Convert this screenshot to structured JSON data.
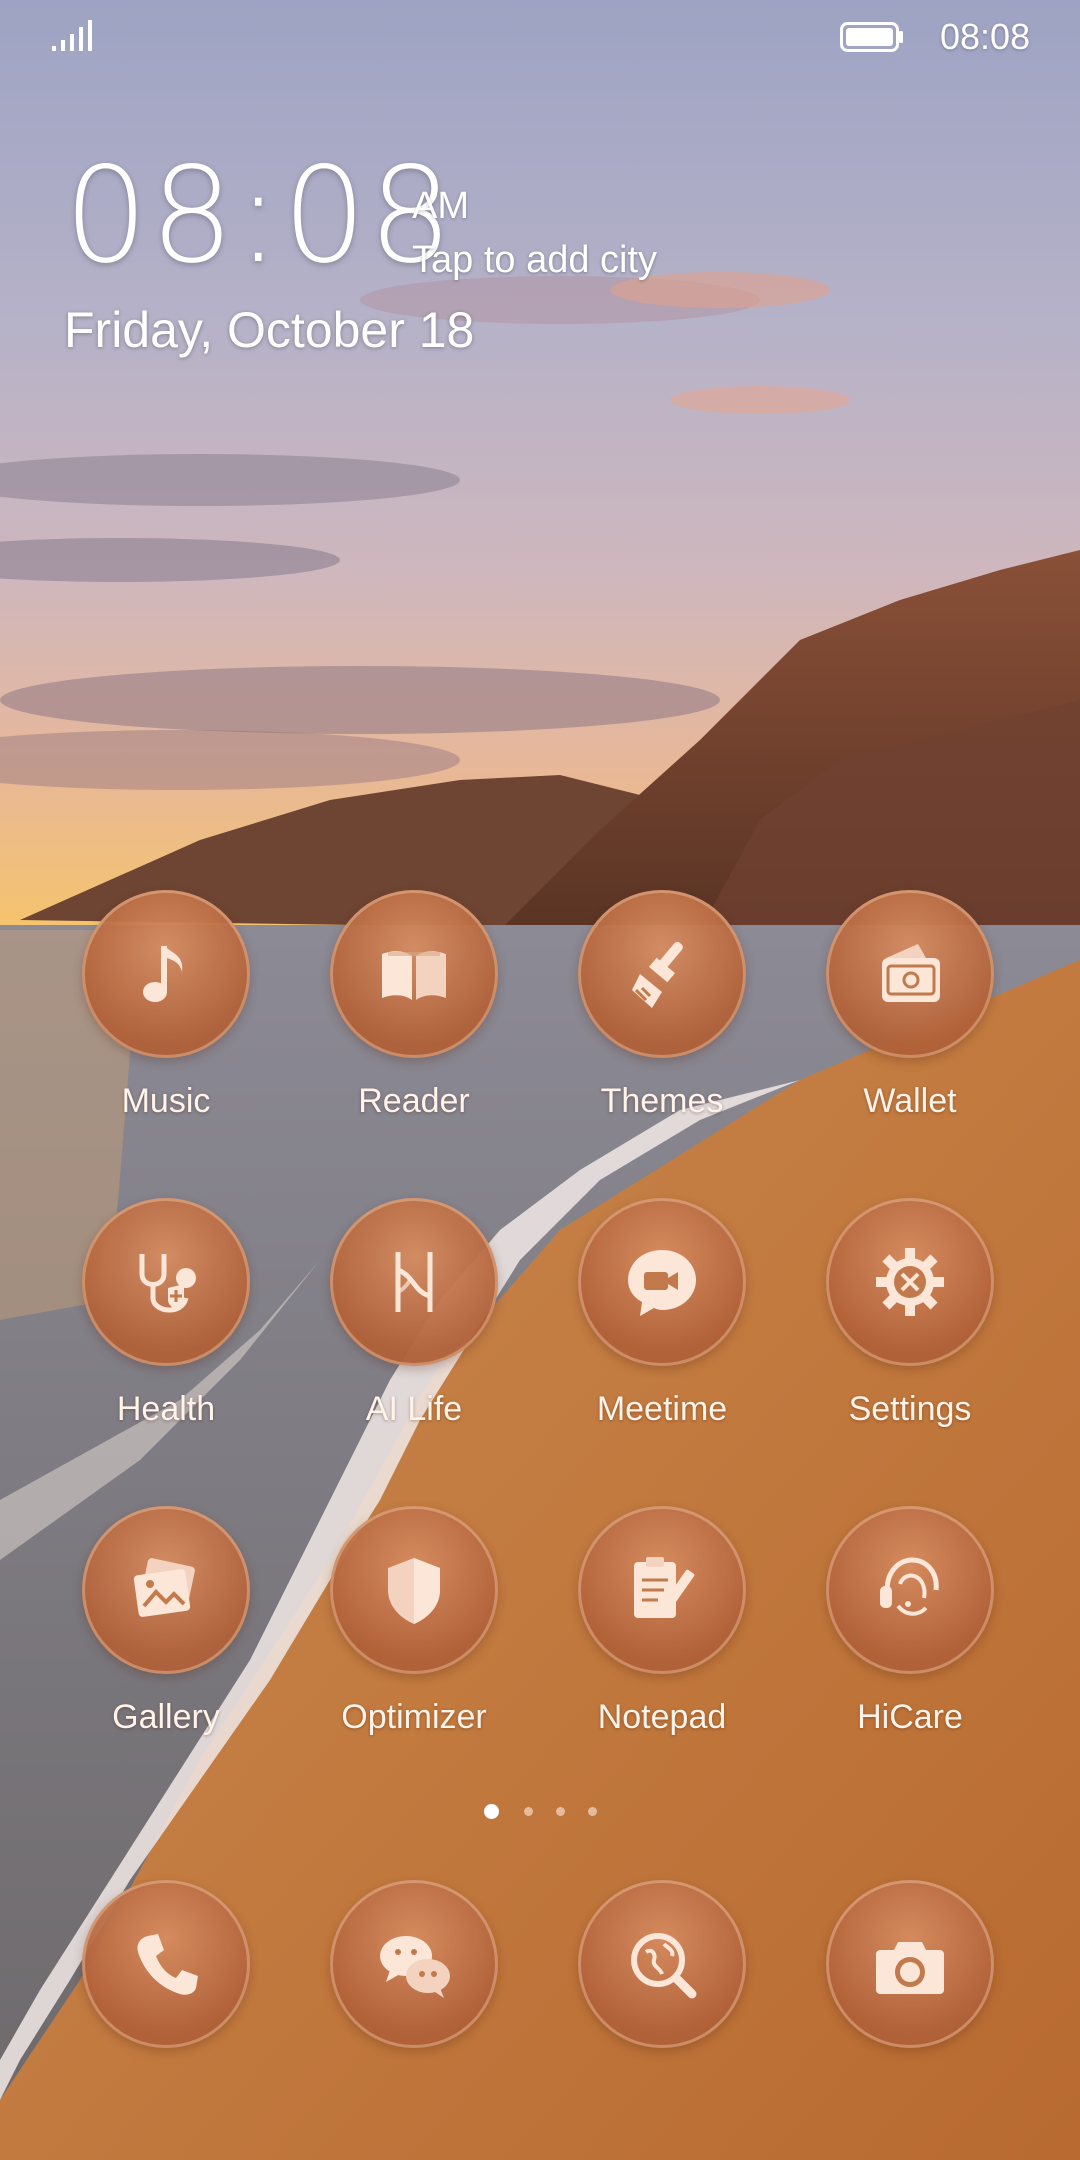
{
  "status_bar": {
    "time": "08:08",
    "signal_icon": "signal-bars-icon",
    "battery_icon": "battery-full-icon"
  },
  "clock_widget": {
    "time": "08:08",
    "ampm": "AM",
    "city_prompt": "Tap to add city",
    "date": "Friday, October 18"
  },
  "apps": [
    {
      "label": "Music",
      "icon": "music-note-icon"
    },
    {
      "label": "Reader",
      "icon": "book-icon"
    },
    {
      "label": "Themes",
      "icon": "paintbrush-icon"
    },
    {
      "label": "Wallet",
      "icon": "wallet-icon"
    },
    {
      "label": "Health",
      "icon": "stethoscope-icon"
    },
    {
      "label": "AI Life",
      "icon": "ai-life-icon"
    },
    {
      "label": "Meetime",
      "icon": "video-chat-icon"
    },
    {
      "label": "Settings",
      "icon": "gear-icon"
    },
    {
      "label": "Gallery",
      "icon": "photos-icon"
    },
    {
      "label": "Optimizer",
      "icon": "shield-icon"
    },
    {
      "label": "Notepad",
      "icon": "notepad-icon"
    },
    {
      "label": "HiCare",
      "icon": "headset-icon"
    }
  ],
  "page_indicator": {
    "pages": 4,
    "current": 1
  },
  "dock": [
    {
      "icon": "phone-icon"
    },
    {
      "icon": "chat-bubbles-icon"
    },
    {
      "icon": "globe-search-icon"
    },
    {
      "icon": "camera-icon"
    }
  ],
  "colors": {
    "icon_fill": "#c27a4c",
    "glyph": "#fbe6d8",
    "sky_top": "#9fa1c0",
    "sand": "#c07a3e"
  }
}
